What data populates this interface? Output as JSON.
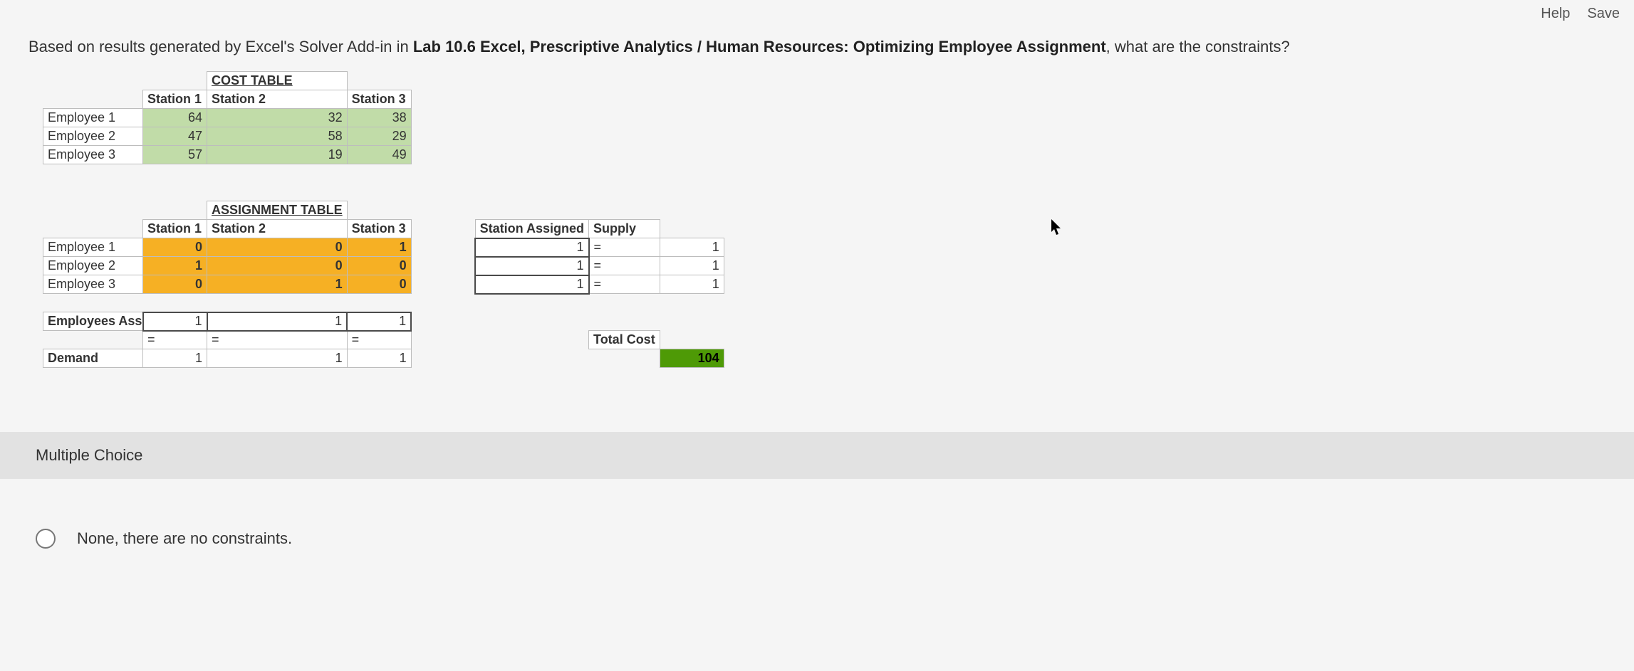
{
  "topbar": {
    "help": "Help",
    "save": "Save"
  },
  "question": {
    "pre": "Based on results generated by Excel's Solver Add-in in ",
    "bold": "Lab 10.6 Excel, Prescriptive Analytics / Human Resources: Optimizing Employee Assignment",
    "post": ", what are the constraints?"
  },
  "cost": {
    "title": "COST TABLE",
    "cols": [
      "Station 1",
      "Station 2",
      "Station 3"
    ],
    "rows": [
      {
        "label": "Employee 1",
        "v": [
          "64",
          "32",
          "38"
        ]
      },
      {
        "label": "Employee 2",
        "v": [
          "47",
          "58",
          "29"
        ]
      },
      {
        "label": "Employee 3",
        "v": [
          "57",
          "19",
          "49"
        ]
      }
    ]
  },
  "assign": {
    "title": "ASSIGNMENT TABLE",
    "cols": [
      "Station 1",
      "Station 2",
      "Station 3"
    ],
    "side_hdr": "Station Assigned",
    "supply_hdr": "Supply",
    "rows": [
      {
        "label": "Employee 1",
        "v": [
          "0",
          "0",
          "1"
        ],
        "sum": "1",
        "op": "=",
        "sup": "1"
      },
      {
        "label": "Employee 2",
        "v": [
          "1",
          "0",
          "0"
        ],
        "sum": "1",
        "op": "=",
        "sup": "1"
      },
      {
        "label": "Employee 3",
        "v": [
          "0",
          "1",
          "0"
        ],
        "sum": "1",
        "op": "=",
        "sup": "1"
      }
    ],
    "emp_assigned_label": "Employees Assigned",
    "emp_assigned": [
      "1",
      "1",
      "1"
    ],
    "eq": [
      "=",
      "=",
      "="
    ],
    "demand_label": "Demand",
    "demand": [
      "1",
      "1",
      "1"
    ],
    "total_label": "Total Cost",
    "total_value": "104"
  },
  "mc": {
    "title": "Multiple Choice"
  },
  "options": {
    "a": "None, there are no constraints."
  }
}
